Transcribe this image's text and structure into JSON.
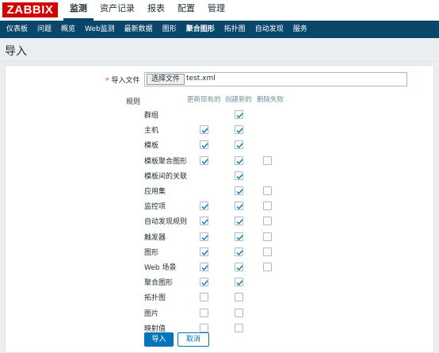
{
  "logo": "ZABBIX",
  "topnav": [
    "监测",
    "资产记录",
    "报表",
    "配置",
    "管理"
  ],
  "topnav_active": 0,
  "subnav": [
    "仪表板",
    "问题",
    "概览",
    "Web监测",
    "最新数据",
    "图形",
    "聚合图形",
    "拓扑图",
    "自动发现",
    "服务"
  ],
  "subnav_active": 6,
  "page_title": "导入",
  "form": {
    "file_label": "导入文件",
    "file_button": "选择文件",
    "file_name": "test.xml",
    "rules_label": "规则",
    "columns": [
      "更新现有的",
      "创建新的",
      "删除失败"
    ],
    "rows": [
      {
        "label": "群组",
        "update": null,
        "create": true,
        "delete": null
      },
      {
        "label": "主机",
        "update": true,
        "create": true,
        "delete": null
      },
      {
        "label": "模板",
        "update": true,
        "create": true,
        "delete": null
      },
      {
        "label": "模板聚合图形",
        "update": true,
        "create": true,
        "delete": false
      },
      {
        "label": "模板间的关联",
        "update": null,
        "create": true,
        "delete": null
      },
      {
        "label": "应用集",
        "update": null,
        "create": true,
        "delete": false
      },
      {
        "label": "监控项",
        "update": true,
        "create": true,
        "delete": false
      },
      {
        "label": "自动发现规则",
        "update": true,
        "create": true,
        "delete": false
      },
      {
        "label": "触发器",
        "update": true,
        "create": true,
        "delete": false
      },
      {
        "label": "图形",
        "update": true,
        "create": true,
        "delete": false
      },
      {
        "label": "Web 场景",
        "update": true,
        "create": true,
        "delete": false
      },
      {
        "label": "聚合图形",
        "update": true,
        "create": true,
        "delete": null
      },
      {
        "label": "拓扑图",
        "update": false,
        "create": false,
        "delete": null
      },
      {
        "label": "图片",
        "update": false,
        "create": false,
        "delete": null
      },
      {
        "label": "映射值",
        "update": false,
        "create": false,
        "delete": null
      }
    ],
    "import_button": "导入",
    "cancel_button": "取消"
  },
  "colors": {
    "accent": "#0275b8",
    "nav": "#0a466a",
    "logo": "#d40000"
  }
}
